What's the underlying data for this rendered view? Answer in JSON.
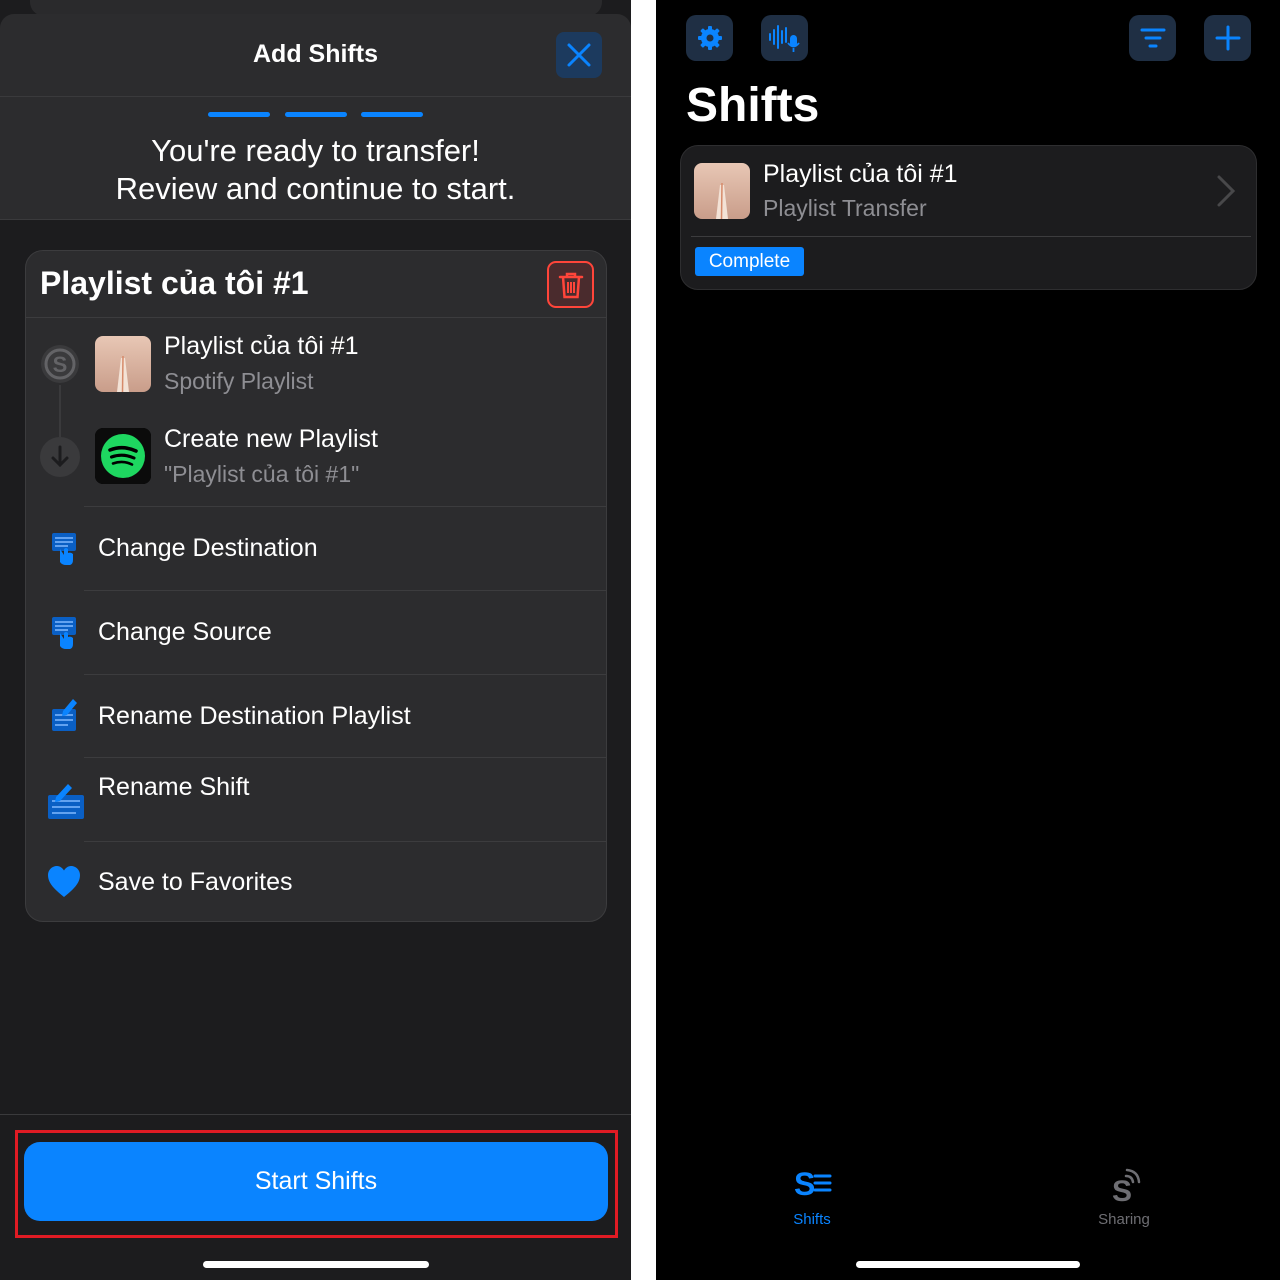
{
  "add_shifts": {
    "title": "Add Shifts",
    "ready_line1": "You're ready to transfer!",
    "ready_line2": "Review and continue to start.",
    "card_title": "Playlist của tôi #1",
    "source": {
      "title": "Playlist của tôi #1",
      "subtitle": "Spotify Playlist"
    },
    "destination": {
      "title": "Create new Playlist",
      "subtitle": "\"Playlist của tôi #1\""
    },
    "options": [
      {
        "label": "Change Destination",
        "icon": "list-hand-icon"
      },
      {
        "label": "Change Source",
        "icon": "list-hand-icon"
      },
      {
        "label": "Rename Destination Playlist",
        "icon": "list-pencil-icon"
      },
      {
        "label": "Rename Shift",
        "icon": "list-pencil-icon"
      },
      {
        "label": "Save to Favorites",
        "icon": "heart-icon"
      }
    ],
    "start_button": "Start Shifts"
  },
  "shifts_screen": {
    "toolbar": {
      "left": [
        "gear-icon",
        "voice-mic-icon"
      ],
      "right": [
        "filter-icon",
        "plus-icon"
      ]
    },
    "title": "Shifts",
    "shift": {
      "title": "Playlist của tôi #1",
      "subtitle": "Playlist Transfer",
      "status": "Complete"
    },
    "tabs": [
      {
        "label": "Shifts",
        "icon": "shifts-tab-icon",
        "active": true
      },
      {
        "label": "Sharing",
        "icon": "sharing-tab-icon",
        "active": false
      }
    ]
  },
  "colors": {
    "accent": "#0a84ff",
    "danger": "#ff453a",
    "highlight_outline": "#e01b24",
    "spotify_green": "#1ed760"
  }
}
